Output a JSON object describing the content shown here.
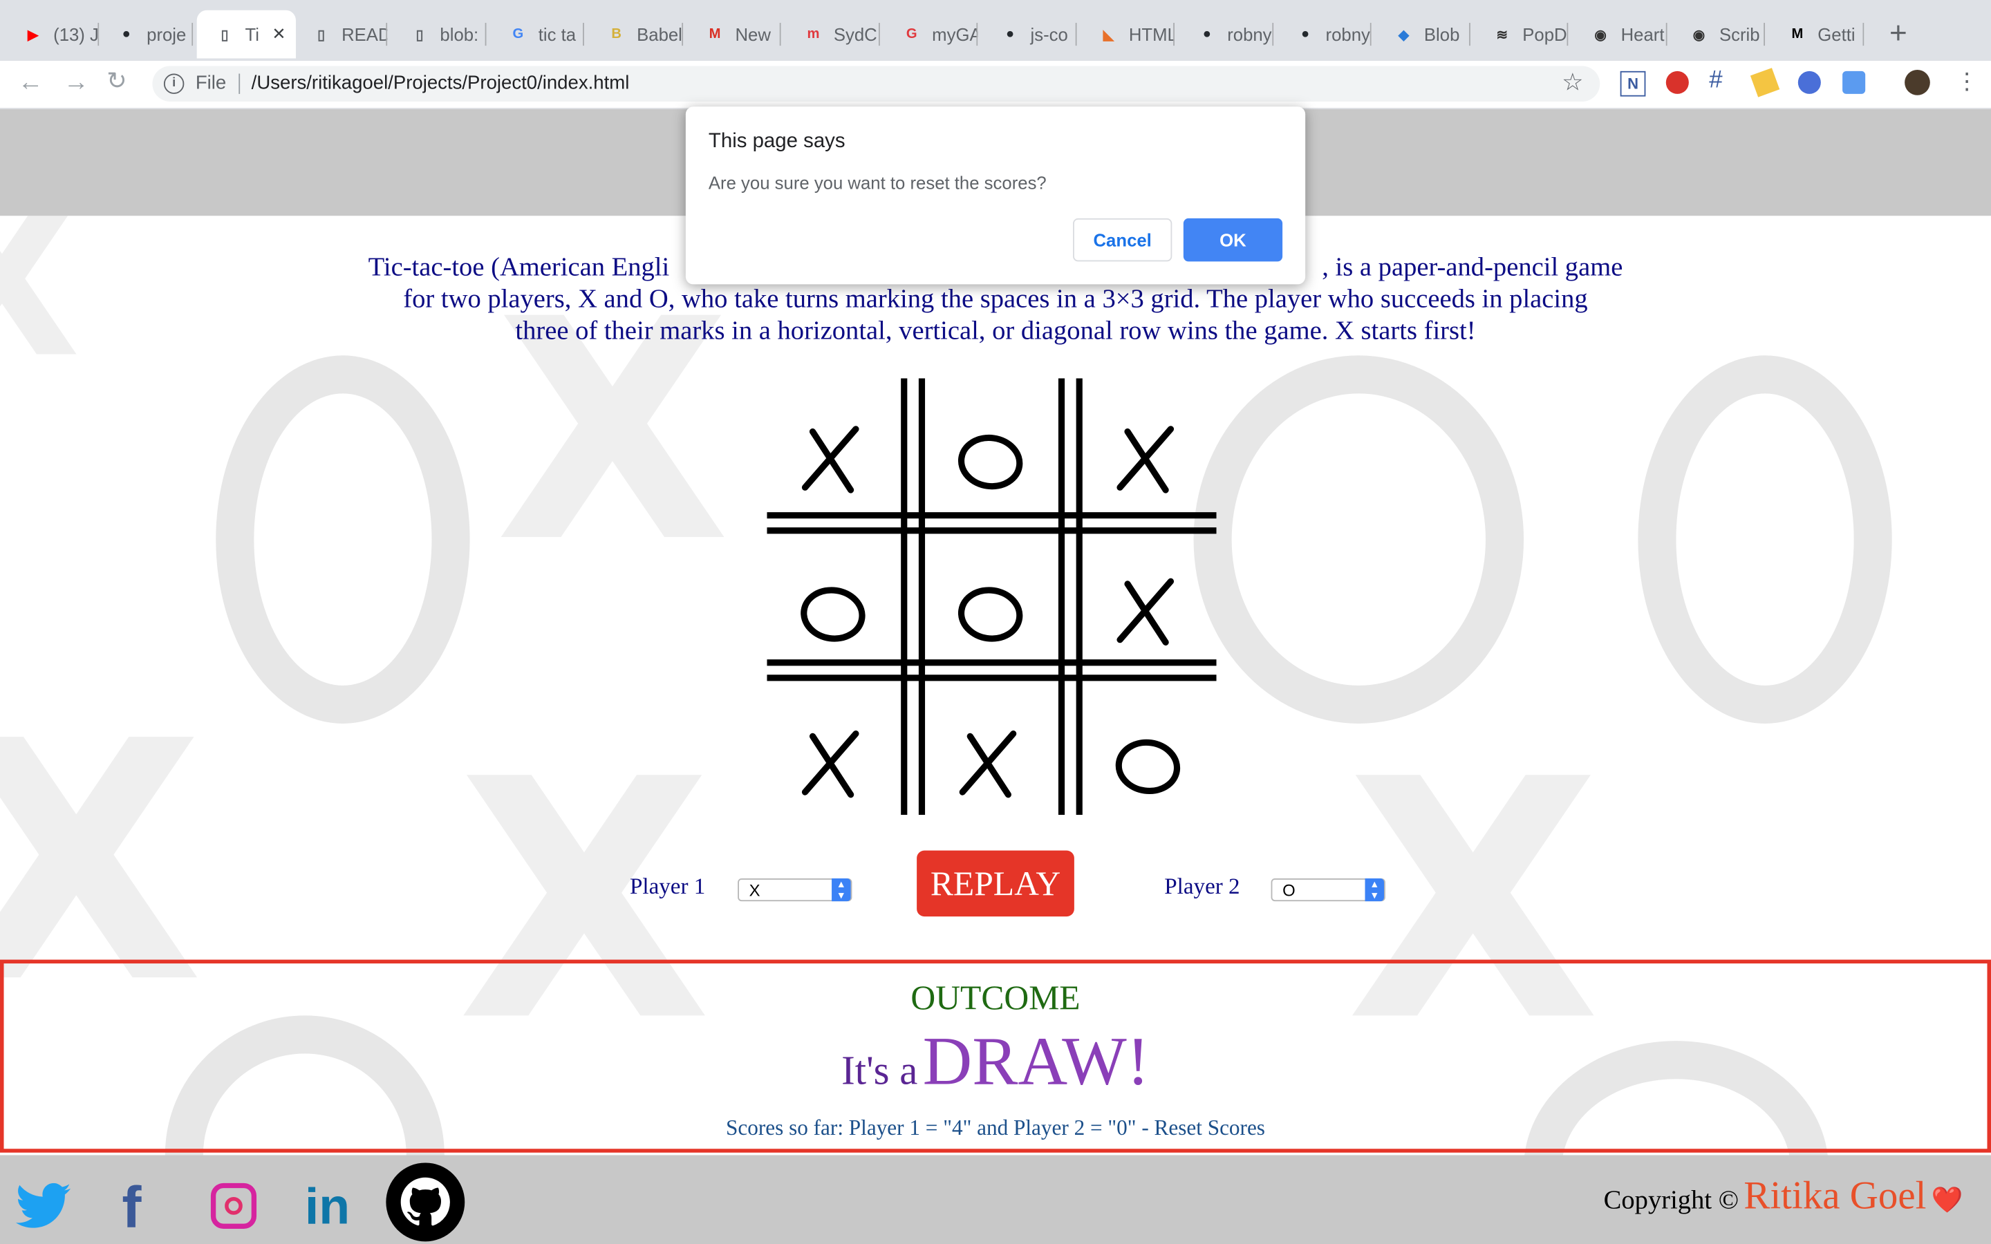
{
  "browser": {
    "tabs": [
      {
        "label": "(13) J",
        "icon": "youtube-icon"
      },
      {
        "label": "proje",
        "icon": "github-icon"
      },
      {
        "label": "Ti",
        "icon": "page-icon",
        "active": true
      },
      {
        "label": "READ",
        "icon": "page-icon"
      },
      {
        "label": "blob:",
        "icon": "page-icon"
      },
      {
        "label": "tic ta",
        "icon": "google-icon"
      },
      {
        "label": "Babel",
        "icon": "babel-icon"
      },
      {
        "label": "New",
        "icon": "gmail-icon"
      },
      {
        "label": "SydC",
        "icon": "meetup-icon"
      },
      {
        "label": "myGA",
        "icon": "ga-icon"
      },
      {
        "label": "js-co",
        "icon": "github-icon"
      },
      {
        "label": "HTML",
        "icon": "html-icon"
      },
      {
        "label": "robny",
        "icon": "github-icon"
      },
      {
        "label": "robny",
        "icon": "github-icon"
      },
      {
        "label": "Blob",
        "icon": "blob-icon"
      },
      {
        "label": "PopD",
        "icon": "popd-icon"
      },
      {
        "label": "Heart",
        "icon": "heart-site-icon"
      },
      {
        "label": "Scrib",
        "icon": "scrib-icon"
      },
      {
        "label": "Getti",
        "icon": "medium-icon"
      }
    ],
    "new_tab": "+",
    "url_scheme": "File",
    "url": "/Users/ritikagoel/Projects/Project0/index.html"
  },
  "dialog": {
    "title": "This page says",
    "message": "Are you sure you want to reset the scores?",
    "cancel_label": "Cancel",
    "ok_label": "OK"
  },
  "game": {
    "description": "Tic-tac-toe (American Engli                                                                             , is a paper-and-pencil game for two players, X and O, who take turns marking the spaces in a 3×3 grid. The player who succeeds in placing three of their marks in a horizontal, vertical, or diagonal row wins the game. X starts first!",
    "description_lines": [
      "Tic-tac-toe (American Engli",
      ", is a paper-and-pencil game",
      "for two players, X and O, who take turns marking the spaces in a 3×3 grid. The player who succeeds in placing",
      "three of their marks in a horizontal, vertical, or diagonal row wins the game. X starts first!"
    ],
    "board": [
      [
        "X",
        "O",
        "X"
      ],
      [
        "O",
        "O",
        "X"
      ],
      [
        "X",
        "X",
        "O"
      ]
    ],
    "player1_label": "Player 1",
    "player1_value": "X",
    "player2_label": "Player 2",
    "player2_value": "O",
    "replay_label": "REPLAY"
  },
  "outcome": {
    "heading": "OUTCOME",
    "prefix": "It's a",
    "result": "DRAW!",
    "scores_text": "Scores so far: Player 1 = \"4\" and Player 2 = \"0\" - Reset Scores"
  },
  "footer": {
    "social": [
      "twitter-icon",
      "facebook-icon",
      "instagram-icon",
      "linkedin-icon",
      "github-icon"
    ],
    "copyright_prefix": "Copyright ©",
    "author": "Ritika Goel",
    "heart": "❤️"
  },
  "colors": {
    "accent_red": "#e53528",
    "text_navy": "#0c0c84",
    "outcome_green": "#1f6a12",
    "draw_purple": "#7a2fa8",
    "dialog_blue": "#3b82f6"
  }
}
